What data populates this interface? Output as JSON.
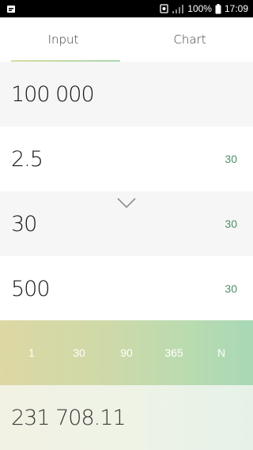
{
  "status_bar": {
    "battery_percent": "100%",
    "time": "17:09"
  },
  "tabs": [
    {
      "label": "Input",
      "active": true
    },
    {
      "label": "Chart",
      "active": false
    }
  ],
  "inputs": [
    {
      "value": "100 000",
      "suffix": ""
    },
    {
      "value": "2.5",
      "suffix": "30"
    },
    {
      "value": "30",
      "suffix": "30"
    },
    {
      "value": "500",
      "suffix": "30"
    }
  ],
  "periods": [
    "1",
    "30",
    "90",
    "365",
    "N"
  ],
  "result": {
    "value": "231 708.11"
  },
  "colors": {
    "accent_green": "#4f8e67",
    "gradient_start": "#ddd8a4",
    "gradient_end": "#a8d8b5"
  }
}
